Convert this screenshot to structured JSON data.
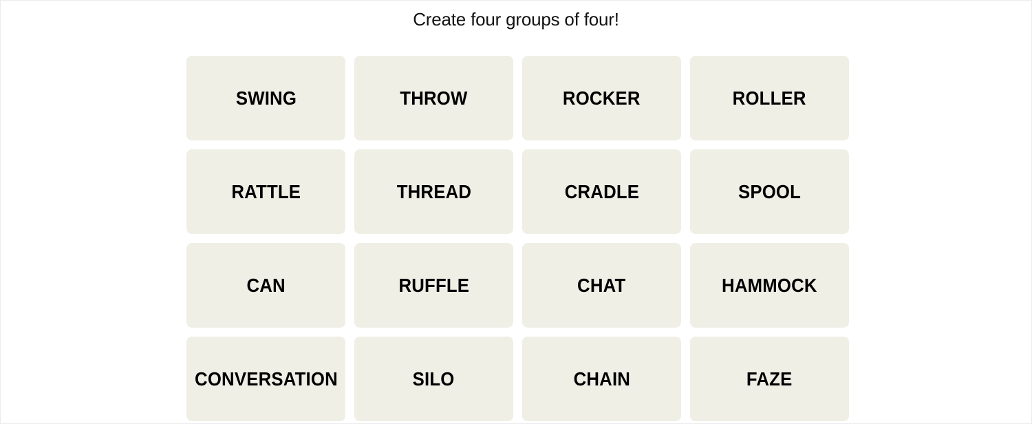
{
  "game": {
    "subtitle": "Create four groups of four!",
    "tile_color": "#efefe6",
    "text_color": "#000000",
    "tiles": [
      {
        "label": "SWING"
      },
      {
        "label": "THROW"
      },
      {
        "label": "ROCKER"
      },
      {
        "label": "ROLLER"
      },
      {
        "label": "RATTLE"
      },
      {
        "label": "THREAD"
      },
      {
        "label": "CRADLE"
      },
      {
        "label": "SPOOL"
      },
      {
        "label": "CAN"
      },
      {
        "label": "RUFFLE"
      },
      {
        "label": "CHAT"
      },
      {
        "label": "HAMMOCK"
      },
      {
        "label": "CONVERSATION"
      },
      {
        "label": "SILO"
      },
      {
        "label": "CHAIN"
      },
      {
        "label": "FAZE"
      }
    ]
  }
}
